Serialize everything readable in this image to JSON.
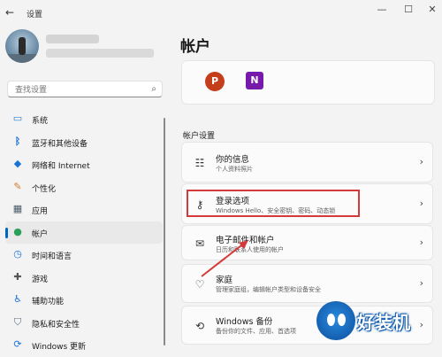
{
  "window": {
    "title": "设置",
    "back_glyph": "←",
    "minimize_glyph": "—",
    "maximize_glyph": "☐",
    "close_glyph": "✕"
  },
  "search": {
    "placeholder": "查找设置"
  },
  "sidebar": {
    "items": [
      {
        "label": "系统",
        "icon": "monitor-icon",
        "active": false
      },
      {
        "label": "蓝牙和其他设备",
        "icon": "bluetooth-icon",
        "active": false
      },
      {
        "label": "网络和 Internet",
        "icon": "wifi-icon",
        "active": false
      },
      {
        "label": "个性化",
        "icon": "brush-icon",
        "active": false
      },
      {
        "label": "应用",
        "icon": "apps-icon",
        "active": false
      },
      {
        "label": "帐户",
        "icon": "person-icon",
        "active": true
      },
      {
        "label": "时间和语言",
        "icon": "globe-clock-icon",
        "active": false
      },
      {
        "label": "游戏",
        "icon": "gamepad-icon",
        "active": false
      },
      {
        "label": "辅助功能",
        "icon": "accessibility-icon",
        "active": false
      },
      {
        "label": "隐私和安全性",
        "icon": "shield-icon",
        "active": false
      },
      {
        "label": "Windows 更新",
        "icon": "windows-update-icon",
        "active": false
      }
    ]
  },
  "main": {
    "heading": "帐户",
    "apps": [
      {
        "letter": "P",
        "icon": "powerpoint-icon",
        "color": "#c43e1c"
      },
      {
        "letter": "N",
        "icon": "onenote-icon",
        "color": "#7719aa"
      }
    ],
    "section_title": "帐户设置",
    "cards": [
      {
        "title": "你的信息",
        "subtitle": "个人资料照片",
        "icon": "person-card-icon"
      },
      {
        "title": "登录选项",
        "subtitle": "Windows Hello、安全密钥、密码、动态锁",
        "icon": "key-icon"
      },
      {
        "title": "电子邮件和帐户",
        "subtitle": "日历和联系人使用的帐户",
        "icon": "mail-icon"
      },
      {
        "title": "家庭",
        "subtitle": "管理家庭组，编辑帐户类型和设备安全",
        "icon": "heart-icon"
      },
      {
        "title": "Windows 备份",
        "subtitle": "备份你的文件、应用、首选项",
        "icon": "backup-icon"
      }
    ],
    "chevron": "›"
  },
  "watermark": {
    "text": "好装机"
  },
  "colors": {
    "accent": "#0067c0",
    "highlight": "#d43a3a"
  }
}
